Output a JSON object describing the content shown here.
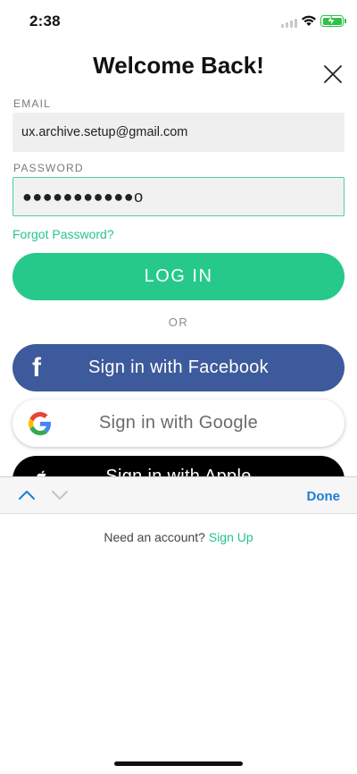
{
  "status_bar": {
    "time": "2:38"
  },
  "header": {
    "title": "Welcome Back!"
  },
  "form": {
    "email_label": "EMAIL",
    "email_value": "ux.archive.setup@gmail.com",
    "password_label": "PASSWORD",
    "password_value": "●●●●●●●●●●●o",
    "forgot_password": "Forgot Password?",
    "login_label": "LOG IN",
    "or_label": "OR"
  },
  "social": {
    "facebook_label": "Sign in with Facebook",
    "google_label": "Sign in with Google",
    "apple_label": "Sign in with Apple"
  },
  "keyboard_toolbar": {
    "done_label": "Done"
  },
  "footer": {
    "prompt": "Need an account?",
    "signup_link": "Sign Up"
  },
  "colors": {
    "accent_green": "#27c98a",
    "link_green": "#27c293",
    "facebook_blue": "#3d5a9c",
    "apple_black": "#000000",
    "done_blue": "#1c7ed6"
  },
  "icons": [
    "wifi-icon",
    "battery-icon",
    "close-icon",
    "facebook-icon",
    "google-icon",
    "apple-icon",
    "chevron-up-icon",
    "chevron-down-icon"
  ]
}
